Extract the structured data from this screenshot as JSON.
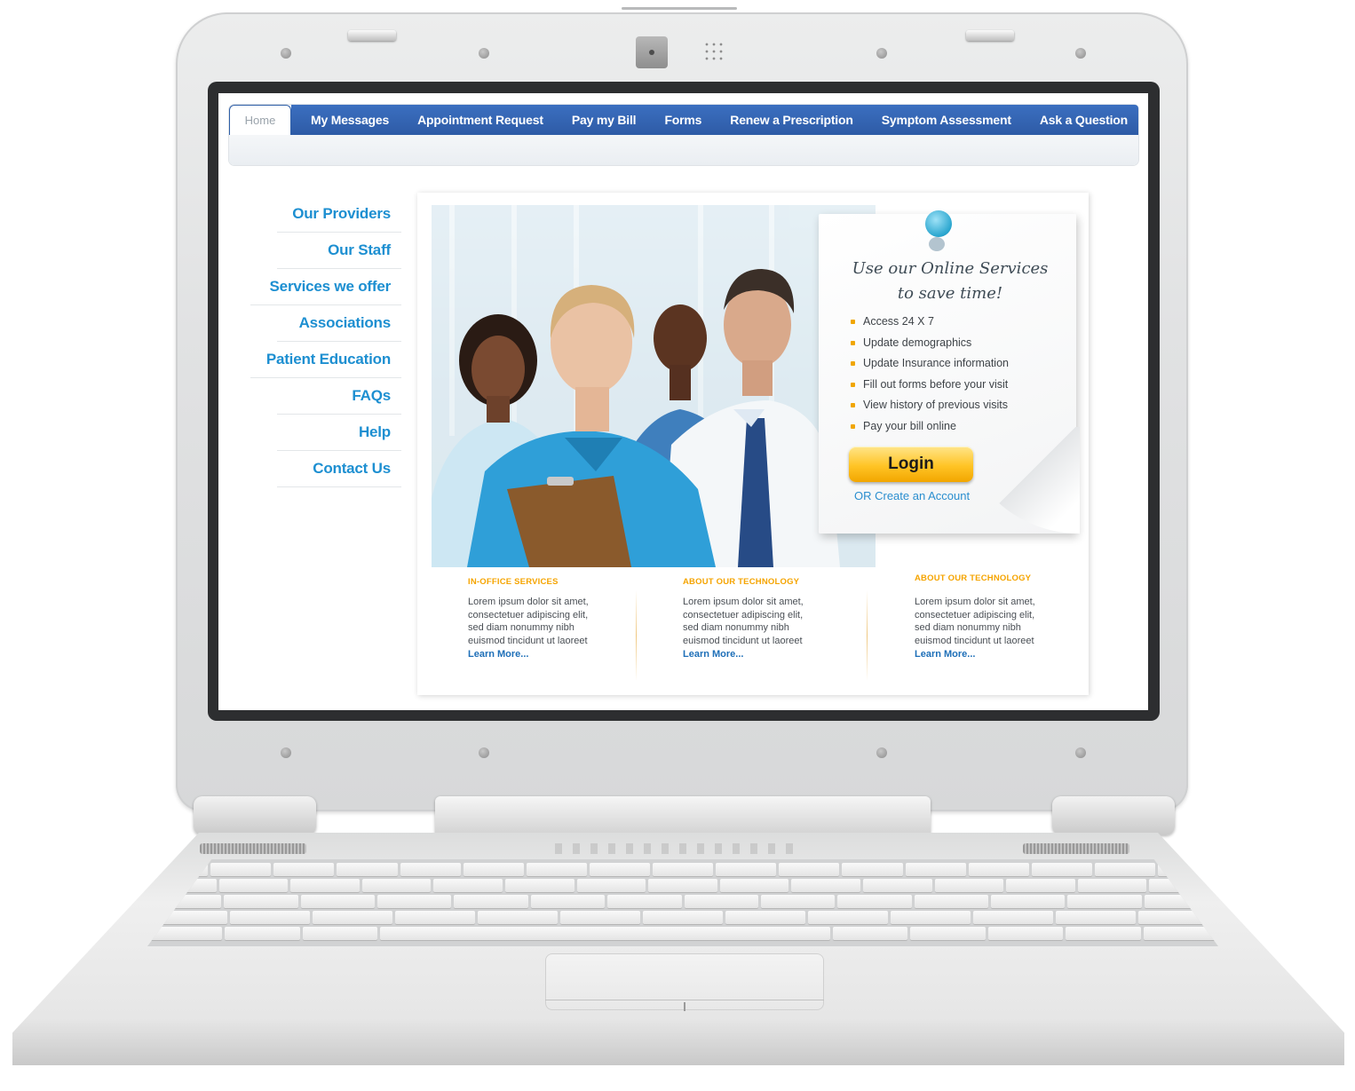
{
  "nav": {
    "home": "Home",
    "items": [
      "My Messages",
      "Appointment Request",
      "Pay my Bill",
      "Forms",
      "Renew a  Prescription",
      "Symptom Assessment",
      "Ask a Question"
    ]
  },
  "sidebar": {
    "items": [
      "Our Providers",
      "Our Staff",
      "Services we offer",
      "Associations",
      "Patient Education",
      "FAQs",
      "Help",
      "Contact Us"
    ]
  },
  "promo": {
    "title_line1": "Use our Online Services",
    "title_line2": "to save time!",
    "features": [
      "Access 24 X 7",
      "Update demographics",
      "Update Insurance information",
      "Fill out forms before your visit",
      "View history of previous visits",
      "Pay your bill online"
    ],
    "login_label": "Login",
    "create_link": "OR Create an Account"
  },
  "columns": [
    {
      "title": "IN-OFFICE SERVICES",
      "body": "Lorem ipsum dolor sit amet, consectetuer adipiscing elit, sed diam nonummy nibh euismod tincidunt ut laoreet",
      "link": "Learn More..."
    },
    {
      "title": "ABOUT OUR TECHNOLOGY",
      "body": "Lorem ipsum dolor sit amet, consectetuer adipiscing elit, sed diam nonummy nibh euismod tincidunt ut laoreet",
      "link": "Learn More..."
    },
    {
      "title": "ABOUT OUR TECHNOLOGY",
      "body": "Lorem ipsum dolor sit amet, consectetuer adipiscing elit, sed diam nonummy nibh euismod tincidunt ut laoreet",
      "link": "Learn More..."
    }
  ],
  "colors": {
    "nav_blue": "#2e5ba6",
    "sidebar_link": "#1d8fd1",
    "accent_orange": "#f5a400",
    "login_yellow": "#ffc425"
  },
  "icons": {
    "pin": "pushpin-icon",
    "bullet": "square-bullet-icon"
  }
}
